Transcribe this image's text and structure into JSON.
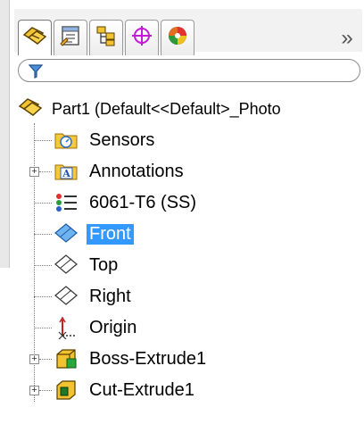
{
  "tabs": [
    {
      "name": "featuremanager-tab",
      "icon": "featuremanager-icon",
      "active": true
    },
    {
      "name": "propertymanager-tab",
      "icon": "propertymanager-icon",
      "active": false
    },
    {
      "name": "configurationmanager-tab",
      "icon": "configurationmanager-icon",
      "active": false
    },
    {
      "name": "dimxpert-tab",
      "icon": "dimxpert-icon",
      "active": false
    },
    {
      "name": "displaymanager-tab",
      "icon": "displaymanager-icon",
      "active": false
    }
  ],
  "more_label": "»",
  "tree": {
    "root_label": "Part1  (Default<<Default>_Photo",
    "items": [
      {
        "label": "Sensors",
        "icon": "sensors-folder-icon",
        "expandable": false
      },
      {
        "label": "Annotations",
        "icon": "annotations-folder-icon",
        "expandable": true
      },
      {
        "label": "6061-T6 (SS)",
        "icon": "material-icon",
        "expandable": false
      },
      {
        "label": "Front",
        "icon": "plane-icon",
        "expandable": false,
        "selected": true
      },
      {
        "label": "Top",
        "icon": "plane-icon",
        "expandable": false
      },
      {
        "label": "Right",
        "icon": "plane-icon",
        "expandable": false
      },
      {
        "label": "Origin",
        "icon": "origin-icon",
        "expandable": false
      },
      {
        "label": "Boss-Extrude1",
        "icon": "boss-extrude-icon",
        "expandable": true
      },
      {
        "label": "Cut-Extrude1",
        "icon": "cut-extrude-icon",
        "expandable": true
      }
    ]
  },
  "colors": {
    "selection": "#3399ff",
    "tree_line": "#7a7a7a"
  }
}
